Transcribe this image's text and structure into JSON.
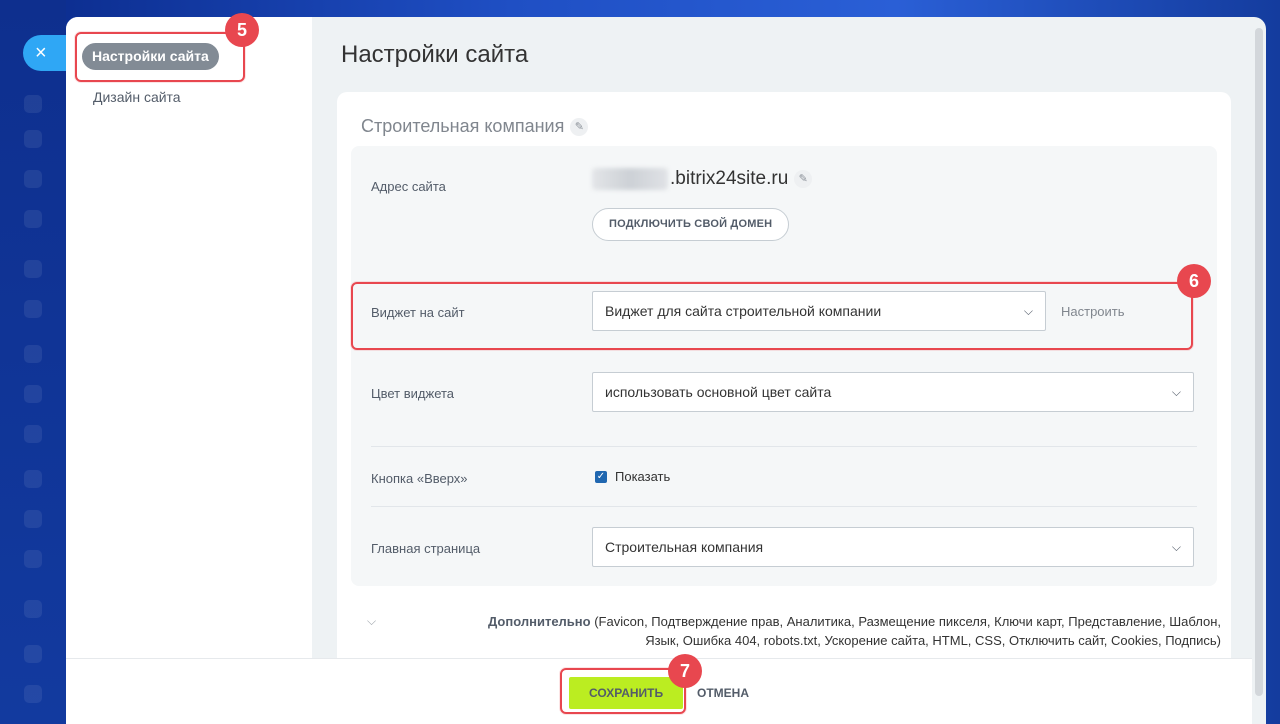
{
  "close_icon": "×",
  "sidebar": {
    "active_item": "Настройки сайта",
    "items": [
      "Дизайн сайта"
    ]
  },
  "page_title": "Настройки сайта",
  "card": {
    "title": "Строительная компания",
    "address": {
      "label": "Адрес сайта",
      "domain_suffix": ".bitrix24site.ru",
      "connect_button": "ПОДКЛЮЧИТЬ СВОЙ ДОМЕН"
    },
    "widget": {
      "label": "Виджет на сайт",
      "value": "Виджет для сайта строительной компании",
      "setup_link": "Настроить"
    },
    "widget_color": {
      "label": "Цвет виджета",
      "value": "использовать основной цвет сайта"
    },
    "up_button": {
      "label": "Кнопка «Вверх»",
      "checkbox_label": "Показать",
      "checked": true
    },
    "home_page": {
      "label": "Главная страница",
      "value": "Строительная компания"
    }
  },
  "additional": {
    "title": "Дополнительно",
    "items_line1": "(Favicon,  Подтверждение прав,  Аналитика,  Размещение пикселя,  Ключи карт,  Представление,  Шаблон,",
    "items_line2": "Язык,  Ошибка 404,  robots.txt,  Ускорение сайта,  HTML,  CSS,  Отключить сайт,  Cookies,  Подпись)"
  },
  "footer": {
    "save": "СОХРАНИТЬ",
    "cancel": "ОТМЕНА"
  },
  "badges": [
    "5",
    "6",
    "7"
  ],
  "colors": {
    "accent_red": "#e8474f",
    "save_green": "#bbed21",
    "active_grey": "#828b95"
  }
}
